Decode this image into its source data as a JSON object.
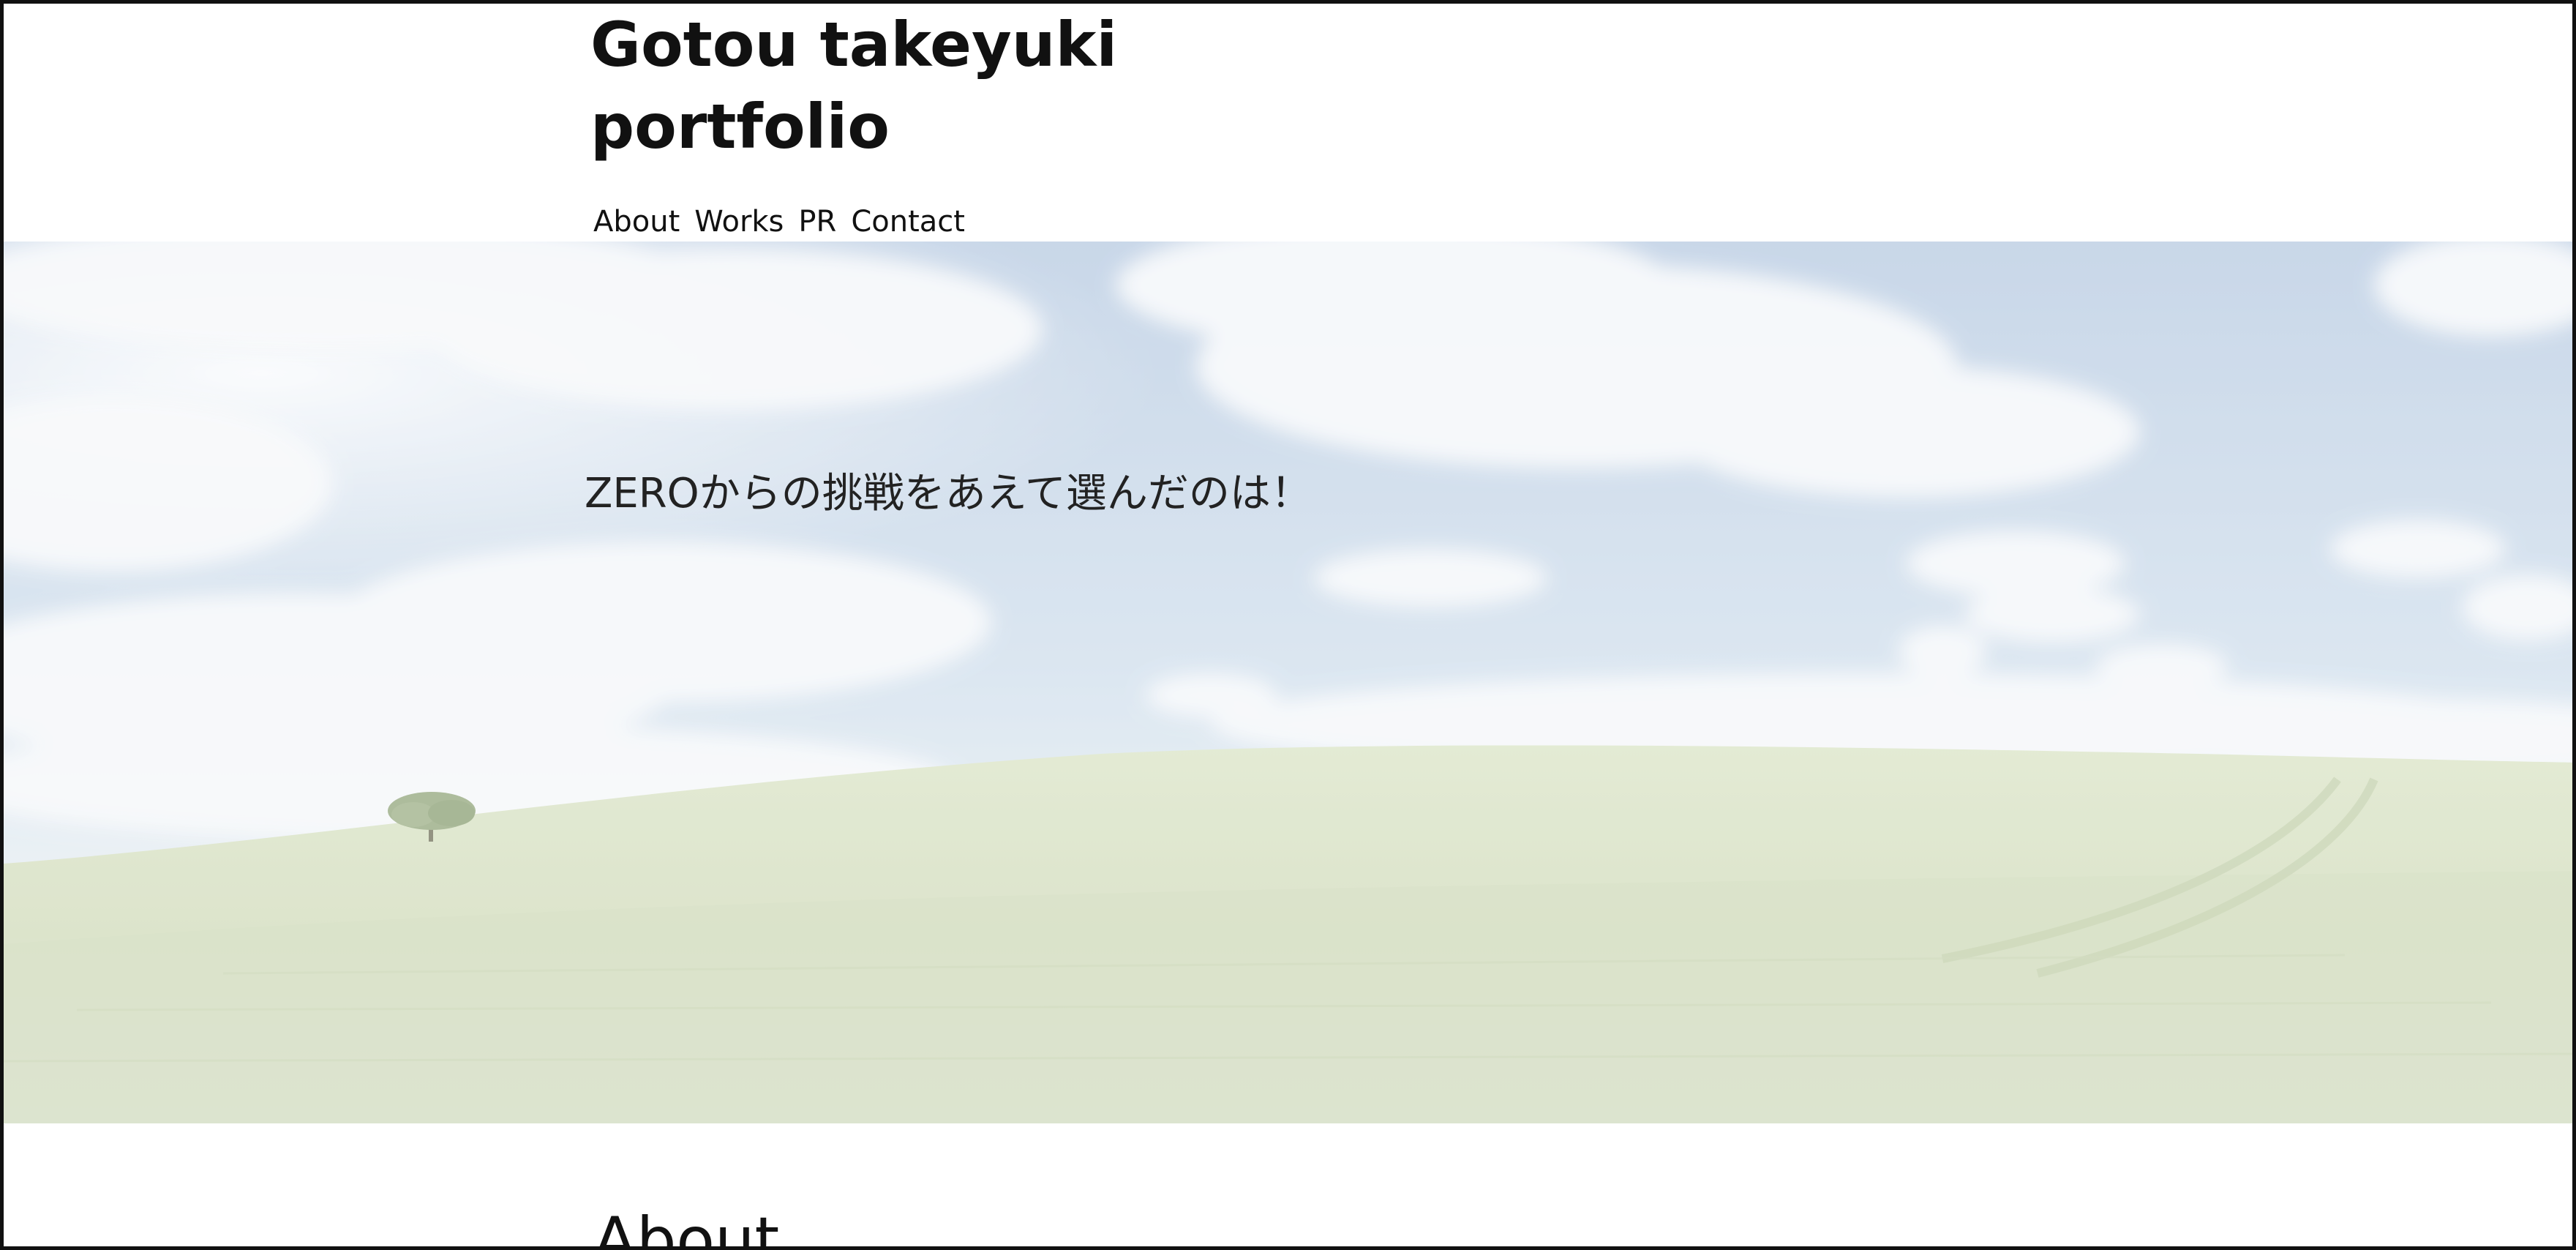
{
  "header": {
    "title_line1": "Gotou takeyuki",
    "title_line2": "portfolio",
    "nav": [
      {
        "label": "About"
      },
      {
        "label": "Works"
      },
      {
        "label": "PR"
      },
      {
        "label": "Contact"
      }
    ]
  },
  "hero": {
    "catch_copy": "ZEROからの挑戦をあえて選んだのは！",
    "image": "sky-and-grass-field"
  },
  "about": {
    "heading": "About"
  },
  "colors": {
    "text": "#111111",
    "background": "#ffffff",
    "sky": "#b9cde3",
    "grass": "#cfdcba"
  }
}
